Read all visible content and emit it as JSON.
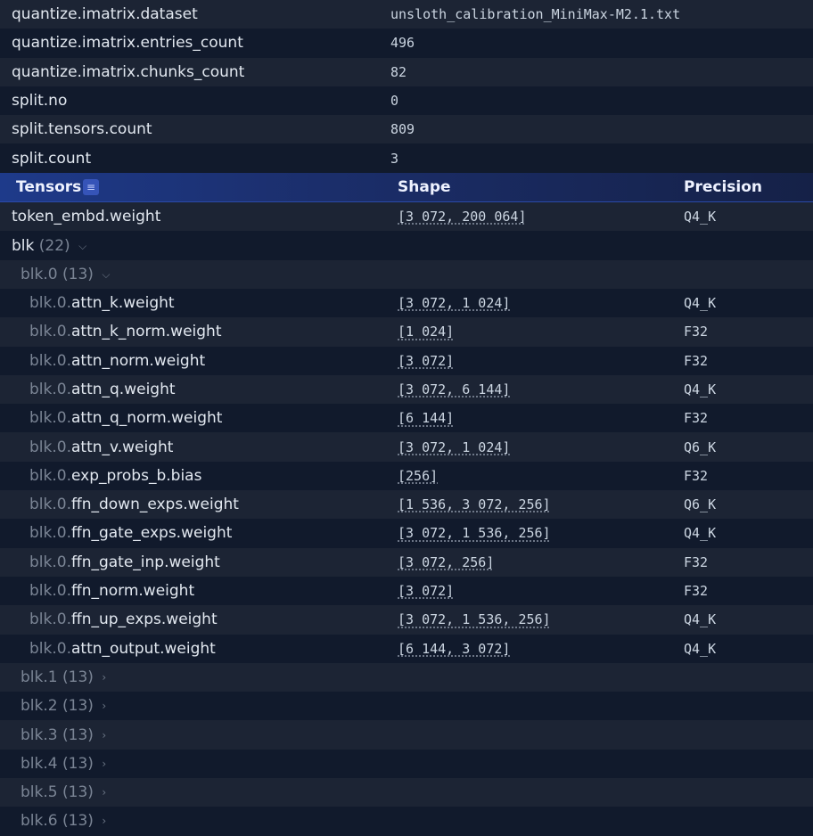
{
  "metadata": [
    {
      "key": "quantize.imatrix.dataset",
      "value": "unsloth_calibration_MiniMax-M2.1.txt"
    },
    {
      "key": "quantize.imatrix.entries_count",
      "value": "496"
    },
    {
      "key": "quantize.imatrix.chunks_count",
      "value": "82"
    },
    {
      "key": "split.no",
      "value": "0"
    },
    {
      "key": "split.tensors.count",
      "value": "809"
    },
    {
      "key": "split.count",
      "value": "3"
    }
  ],
  "tensors_header": {
    "title": "Tensors",
    "menu_icon": "≡",
    "shape": "Shape",
    "precision": "Precision"
  },
  "token_embd": {
    "name": "token_embd.weight",
    "shape": "[3 072, 200 064]",
    "precision": "Q4_K"
  },
  "blk_group": {
    "name": "blk",
    "count": "(22)",
    "chevron": "⌵"
  },
  "blk0_group": {
    "prefix": "blk.",
    "index": "0",
    "count": "(13)",
    "chevron": "⌵"
  },
  "blk0_tensors": [
    {
      "prefix": "blk.0.",
      "name": "attn_k.weight",
      "shape": "[3 072, 1 024]",
      "precision": "Q4_K"
    },
    {
      "prefix": "blk.0.",
      "name": "attn_k_norm.weight",
      "shape": "[1 024]",
      "precision": "F32"
    },
    {
      "prefix": "blk.0.",
      "name": "attn_norm.weight",
      "shape": "[3 072]",
      "precision": "F32"
    },
    {
      "prefix": "blk.0.",
      "name": "attn_q.weight",
      "shape": "[3 072, 6 144]",
      "precision": "Q4_K"
    },
    {
      "prefix": "blk.0.",
      "name": "attn_q_norm.weight",
      "shape": "[6 144]",
      "precision": "F32"
    },
    {
      "prefix": "blk.0.",
      "name": "attn_v.weight",
      "shape": "[3 072, 1 024]",
      "precision": "Q6_K"
    },
    {
      "prefix": "blk.0.",
      "name": "exp_probs_b.bias",
      "shape": "[256]",
      "precision": "F32"
    },
    {
      "prefix": "blk.0.",
      "name": "ffn_down_exps.weight",
      "shape": "[1 536, 3 072, 256]",
      "precision": "Q6_K"
    },
    {
      "prefix": "blk.0.",
      "name": "ffn_gate_exps.weight",
      "shape": "[3 072, 1 536, 256]",
      "precision": "Q4_K"
    },
    {
      "prefix": "blk.0.",
      "name": "ffn_gate_inp.weight",
      "shape": "[3 072, 256]",
      "precision": "F32"
    },
    {
      "prefix": "blk.0.",
      "name": "ffn_norm.weight",
      "shape": "[3 072]",
      "precision": "F32"
    },
    {
      "prefix": "blk.0.",
      "name": "ffn_up_exps.weight",
      "shape": "[3 072, 1 536, 256]",
      "precision": "Q4_K"
    },
    {
      "prefix": "blk.0.",
      "name": "attn_output.weight",
      "shape": "[6 144, 3 072]",
      "precision": "Q4_K"
    }
  ],
  "collapsed_blocks": [
    {
      "prefix": "blk.",
      "index": "1",
      "count": "(13)",
      "chevron": "›"
    },
    {
      "prefix": "blk.",
      "index": "2",
      "count": "(13)",
      "chevron": "›"
    },
    {
      "prefix": "blk.",
      "index": "3",
      "count": "(13)",
      "chevron": "›"
    },
    {
      "prefix": "blk.",
      "index": "4",
      "count": "(13)",
      "chevron": "›"
    },
    {
      "prefix": "blk.",
      "index": "5",
      "count": "(13)",
      "chevron": "›"
    },
    {
      "prefix": "blk.",
      "index": "6",
      "count": "(13)",
      "chevron": "›"
    }
  ]
}
